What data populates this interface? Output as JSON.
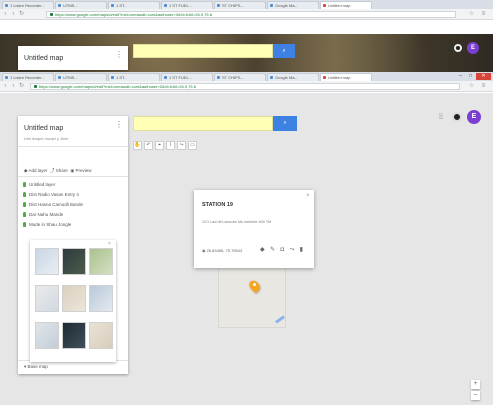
{
  "background_window": {
    "tabs": [
      {
        "label": "1 Listen Recorder..."
      },
      {
        "label": "UTMS..."
      },
      {
        "label": "1 ST..."
      },
      {
        "label": "1 ST FUEL..."
      },
      {
        "label": "ST CHIPS..."
      },
      {
        "label": "Google Ma..."
      },
      {
        "label": "Untitled map"
      }
    ],
    "url": "https://www.google.com/maps/d/edit?mid=zmdaudb.com&authuser=0&hl=fr&ll=26.9,75.8",
    "map_title": "Untitled map",
    "avatar_letter": "E"
  },
  "browser": {
    "tabs": [
      {
        "label": "1 Listen Recorder..."
      },
      {
        "label": "UTMS..."
      },
      {
        "label": "1 ST..."
      },
      {
        "label": "1 ST FUEL..."
      },
      {
        "label": "ST CHIPS..."
      },
      {
        "label": "Google Ma..."
      },
      {
        "label": "Untitled map"
      }
    ],
    "url": "https://www.google.com/maps/d/edit?mid=zmdaudb.com&authuser=0&hl=fr&ll=26.9,75.8"
  },
  "panel": {
    "title": "Untitled map",
    "description": "Ulm Amper vocart y 1inle",
    "actions": [
      "Add layer",
      "Share",
      "Preview"
    ],
    "layers": [
      "Untitled layer",
      "Dist Radio Vasan Entry 4",
      "Dist Hasna Camodli Bande",
      "Dar Nahu Mande",
      "Mude in Shau Jongle"
    ],
    "base_map_label": "Base map"
  },
  "toolbar": {
    "tools": [
      "hand-icon",
      "undo-icon",
      "marker-icon",
      "polyline-icon",
      "route-icon",
      "ruler-icon"
    ]
  },
  "info_window": {
    "title": "STATION 19",
    "description": "11/1 Lad dil Lancolm Mu neintele 400 TM",
    "coords": "26.83456, 75.76943"
  },
  "avatar_letter": "E",
  "colors": {
    "search_bg": "#ffffb5",
    "search_button": "#3d82e3",
    "avatar": "#7a3fd0",
    "pin": "#f5a623",
    "layer_pin": "#4caf3d"
  }
}
